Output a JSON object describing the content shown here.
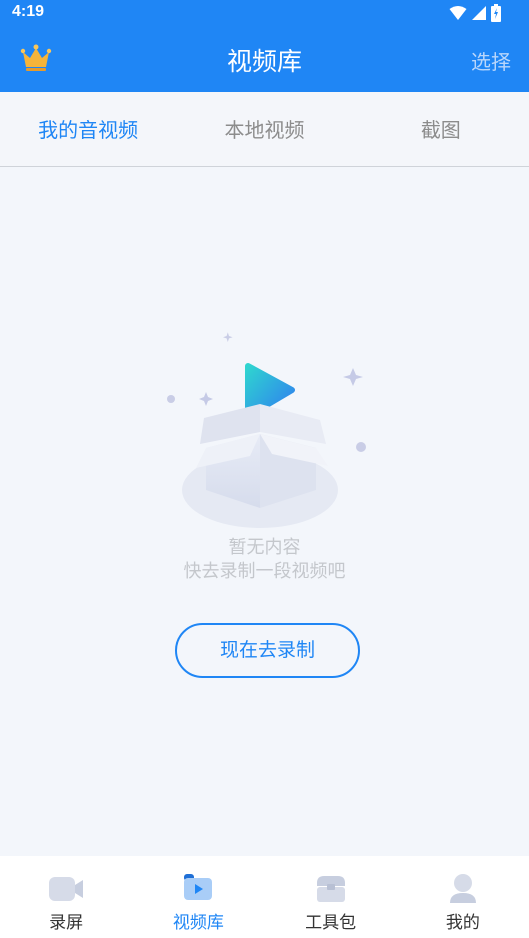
{
  "status": {
    "time": "4:19"
  },
  "header": {
    "title": "视频库",
    "action_label": "选择"
  },
  "tabs": [
    {
      "label": "我的音视频",
      "active": true
    },
    {
      "label": "本地视频",
      "active": false
    },
    {
      "label": "截图",
      "active": false
    }
  ],
  "empty": {
    "title": "暂无内容",
    "subtitle": "快去录制一段视频吧",
    "button_label": "现在去录制"
  },
  "bottom_nav": [
    {
      "label": "录屏",
      "icon": "video-camera-icon",
      "active": false
    },
    {
      "label": "视频库",
      "icon": "video-library-icon",
      "active": true
    },
    {
      "label": "工具包",
      "icon": "toolbox-icon",
      "active": false
    },
    {
      "label": "我的",
      "icon": "user-icon",
      "active": false
    }
  ],
  "colors": {
    "accent": "#1f86f5",
    "background": "#f3f6fb",
    "crown": "#f5b43a"
  }
}
